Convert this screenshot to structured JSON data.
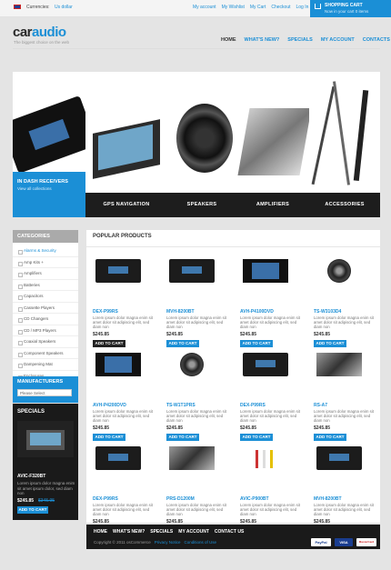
{
  "topbar": {
    "currency_label": "Currencies:",
    "currency_value": "Us dollar",
    "links": [
      "My account",
      "My Wishlist",
      "My Cart",
      "Checkout",
      "Log In"
    ],
    "cart_title": "SHOPPING CART",
    "cart_subtitle": "Now in your cart 0 items"
  },
  "header": {
    "logo_part1": "car",
    "logo_part2": "audio",
    "slogan": "The biggest choice on the web",
    "nav": [
      "HOME",
      "WHAT'S NEW?",
      "SPECIALS",
      "MY ACCOUNT",
      "CONTACTS"
    ]
  },
  "banner": {
    "promo_title": "IN DASH RECEIVERS",
    "promo_link": "View all collections",
    "panels": [
      "GPS NAVIGATION",
      "SPEAKERS",
      "AMPLIFIERS",
      "ACCESSORIES"
    ]
  },
  "sidebar": {
    "categories_title": "CATEGORIES",
    "categories": [
      "Alarms & Security",
      "Amp Kits +",
      "Amplifiers",
      "Batteries",
      "Capacitors",
      "Cassette Players",
      "CD Changers",
      "CD / MP3 Players",
      "Coaxial Speakers",
      "Component Speakers",
      "Dampening Mat",
      "Enclosures"
    ],
    "manufacturers_title": "MANUFACTURERS",
    "manufacturers_select": "Please Select",
    "specials_title": "SPECIALS",
    "special": {
      "name": "AVIC-F320BT",
      "desc": "Lorem ipsum dolor magna enim sit amet ipsum dolor, sed diam non",
      "price": "$245.85",
      "old_price": "$345.95",
      "button": "ADD TO CART"
    }
  },
  "content": {
    "title": "POPULAR PRODUCTS",
    "products": [
      {
        "name": "DEX-P99RS",
        "desc": "Lorem ipsum dolor magna enim sit amet dolor sit adipiscing elit, sed diam non",
        "price": "$245.85",
        "button": "ADD TO CART"
      },
      {
        "name": "MVH-8200BT",
        "desc": "Lorem ipsum dolor magna enim sit amet dolor sit adipiscing elit, sed diam non",
        "price": "$245.85",
        "button": "ADD TO CART"
      },
      {
        "name": "AVH-P4100DVD",
        "desc": "Lorem ipsum dolor magna enim sit amet dolor sit adipiscing elit, sed diam non",
        "price": "$245.85",
        "button": "ADD TO CART"
      },
      {
        "name": "TS-W3103D4",
        "desc": "Lorem ipsum dolor magna enim sit amet dolor sit adipiscing elit, sed diam non",
        "price": "$245.85",
        "button": "ADD TO CART"
      },
      {
        "name": "AVH-P4200DVD",
        "desc": "Lorem ipsum dolor magna enim sit amet dolor sit adipiscing elit, sed diam non",
        "price": "$245.85",
        "button": "ADD TO CART"
      },
      {
        "name": "TS-W1T1PRS",
        "desc": "Lorem ipsum dolor magna enim sit amet dolor sit adipiscing elit, sed diam non",
        "price": "$245.85",
        "button": "ADD TO CART"
      },
      {
        "name": "DEX-P99RS",
        "desc": "Lorem ipsum dolor magna enim sit amet dolor sit adipiscing elit, sed diam non",
        "price": "$245.85",
        "button": "ADD TO CART"
      },
      {
        "name": "RS-A7",
        "desc": "Lorem ipsum dolor magna enim sit amet dolor sit adipiscing elit, sed diam non",
        "price": "$245.85",
        "button": "ADD TO CART"
      },
      {
        "name": "DEX-P99RS",
        "desc": "Lorem ipsum dolor magna enim sit amet dolor sit adipiscing elit, sed diam non",
        "price": "$245.85",
        "button": "ADD TO CART"
      },
      {
        "name": "PRS-D1200M",
        "desc": "Lorem ipsum dolor magna enim sit amet dolor sit adipiscing elit, sed diam non",
        "price": "$245.85",
        "button": "ADD TO CART"
      },
      {
        "name": "AVIC-P900BT",
        "desc": "Lorem ipsum dolor magna enim sit amet dolor sit adipiscing elit, sed diam non",
        "price": "$245.85",
        "button": "ADD TO CART"
      },
      {
        "name": "MVH-8200BT",
        "desc": "Lorem ipsum dolor magna enim sit amet dolor sit adipiscing elit, sed diam non",
        "price": "$245.85",
        "button": "ADD TO CART"
      }
    ]
  },
  "footer": {
    "nav": [
      "HOME",
      "WHAT'S NEW?",
      "SPECIALS",
      "MY ACCOUNT",
      "CONTACT US"
    ],
    "copyright": "Copyright © 2011 osCommerce",
    "privacy": "Privacy Notice",
    "conditions": "Conditions of Use",
    "payments": [
      "PayPal",
      "VISA",
      "MasterCard"
    ]
  },
  "colors": {
    "accent": "#1b8fd6",
    "dark": "#1a1a1a"
  }
}
